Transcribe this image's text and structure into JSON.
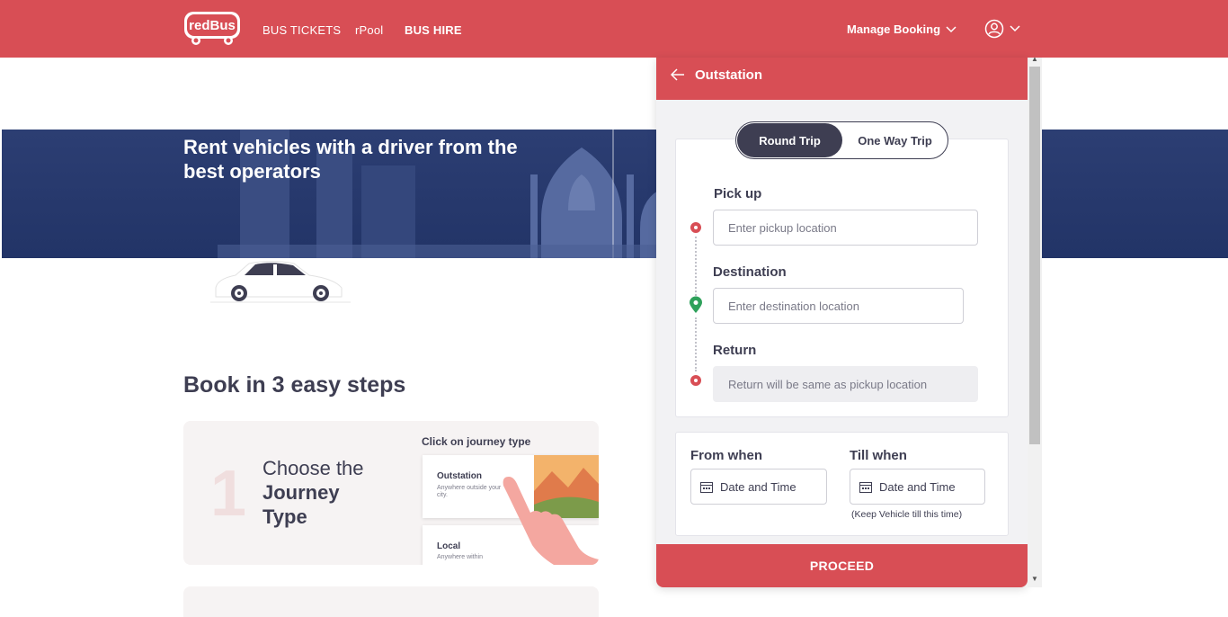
{
  "nav": {
    "brand": "redBus",
    "links": [
      "BUS TICKETS",
      "rPool",
      "BUS HIRE"
    ],
    "manage_booking": "Manage Booking"
  },
  "hero": {
    "title": "Rent vehicles with a driver from the best operators"
  },
  "steps": {
    "title": "Book in 3 easy steps",
    "step1": {
      "number": "1",
      "line1": "Choose the",
      "line2": "Journey",
      "line3": "Type",
      "hint": "Click on journey type",
      "option1_title": "Outstation",
      "option1_sub": "Anywhere outside your city.",
      "option2_title": "Local",
      "option2_sub": "Anywhere within"
    }
  },
  "booking": {
    "header": "Outstation",
    "trip_types": [
      "Round Trip",
      "One Way Trip"
    ],
    "selected_trip": "Round Trip",
    "pickup": {
      "label": "Pick up",
      "placeholder": "Enter pickup location"
    },
    "destination": {
      "label": "Destination",
      "placeholder": "Enter destination location"
    },
    "return": {
      "label": "Return",
      "placeholder": "Return will be same as pickup location"
    },
    "from_when": {
      "label": "From when",
      "value": "Date and Time"
    },
    "till_when": {
      "label": "Till when",
      "value": "Date and Time",
      "note": "(Keep Vehicle till this time)"
    },
    "proceed": "PROCEED"
  },
  "colors": {
    "brand_red": "#d84e55",
    "dark_navy": "#3e3e52",
    "hero_blue": "#2c3e73",
    "dest_green": "#2fa15b"
  },
  "icons": [
    "redbus-logo",
    "chevron-down-icon",
    "user-icon",
    "back-arrow-icon",
    "location-dot-icon",
    "map-pin-icon",
    "calendar-icon"
  ]
}
